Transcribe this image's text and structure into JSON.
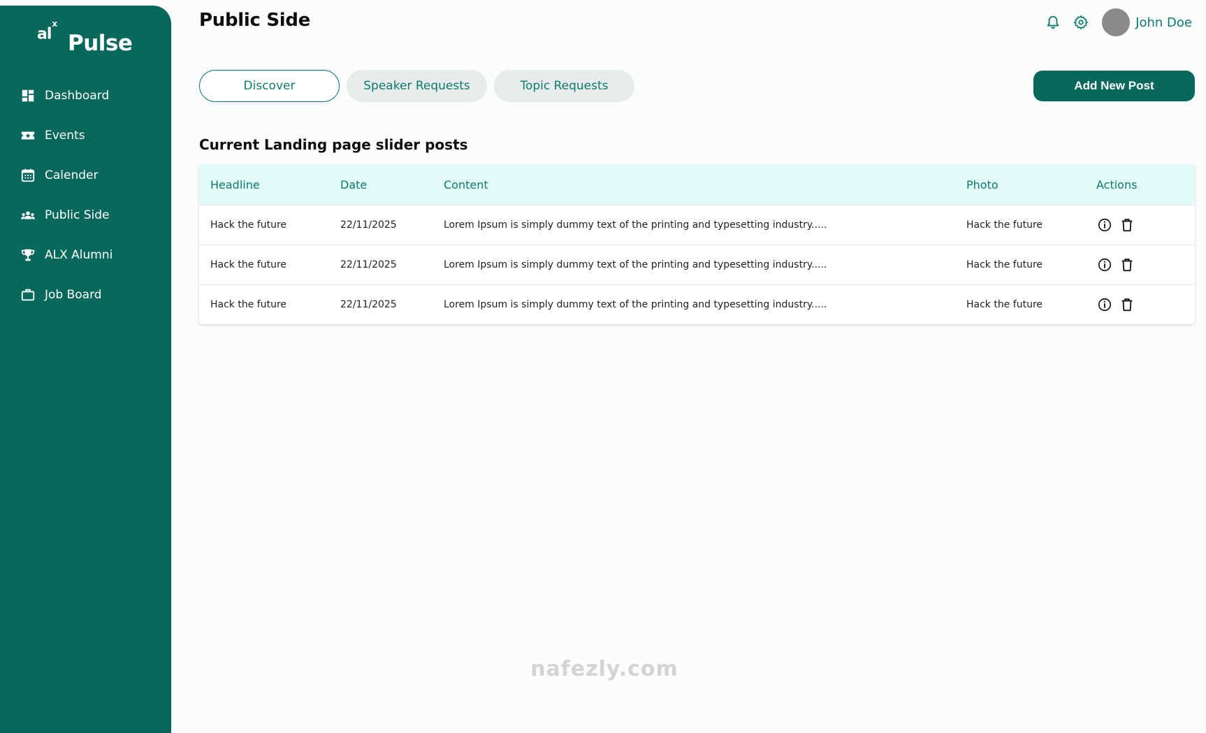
{
  "brand": {
    "alx": "al",
    "sup": "x",
    "name": "Pulse"
  },
  "sidebar": {
    "items": [
      {
        "label": "Dashboard",
        "icon": "dashboard-icon"
      },
      {
        "label": "Events",
        "icon": "ticket-icon"
      },
      {
        "label": "Calender",
        "icon": "calendar-icon"
      },
      {
        "label": "Public Side",
        "icon": "group-icon"
      },
      {
        "label": "ALX Alumni",
        "icon": "trophy-icon"
      },
      {
        "label": "Job Board",
        "icon": "briefcase-icon"
      }
    ]
  },
  "header": {
    "title": "Public Side",
    "user_name": "John Doe",
    "icons": [
      "bell-icon",
      "gear-icon"
    ]
  },
  "tabs": [
    {
      "label": "Discover",
      "active": true
    },
    {
      "label": "Speaker Requests",
      "active": false
    },
    {
      "label": "Topic Requests",
      "active": false
    }
  ],
  "actions": {
    "add_label": "Add New Post"
  },
  "section": {
    "title": "Current Landing page slider posts"
  },
  "table": {
    "columns": [
      "Headline",
      "Date",
      "Content",
      "Photo",
      "Actions"
    ],
    "rows": [
      {
        "headline": "Hack the future",
        "date": "22/11/2025",
        "content": "Lorem Ipsum is simply dummy text of the printing and typesetting industry.....",
        "photo": "Hack the future"
      },
      {
        "headline": "Hack the future",
        "date": "22/11/2025",
        "content": "Lorem Ipsum is simply dummy text of the printing and typesetting industry.....",
        "photo": "Hack the future"
      },
      {
        "headline": "Hack the future",
        "date": "22/11/2025",
        "content": "Lorem Ipsum is simply dummy text of the printing and typesetting industry.....",
        "photo": "Hack the future"
      }
    ]
  },
  "watermark": {
    "text": "nafezly.com"
  },
  "colors": {
    "primary": "#08685b",
    "accent_text": "#0e7a6b",
    "table_header_bg": "#e3fbf7",
    "tab_inactive_bg": "#e8ebec",
    "avatar": "#8a8a8a"
  }
}
